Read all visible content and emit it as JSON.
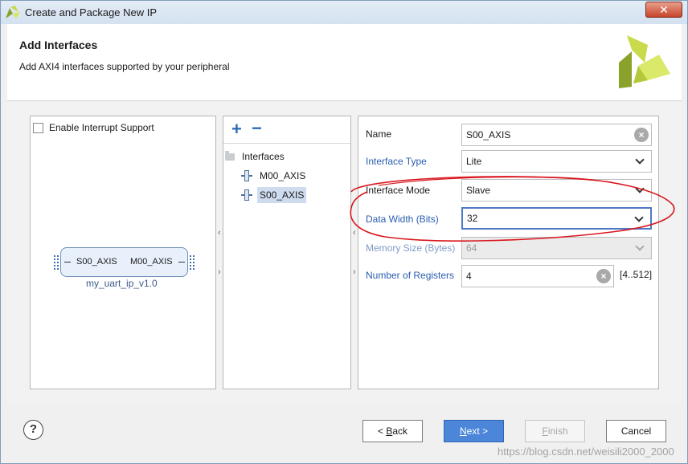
{
  "window": {
    "title": "Create and Package New IP",
    "close_label": "✕"
  },
  "header": {
    "title": "Add Interfaces",
    "subtitle": "Add AXI4 interfaces supported by your peripheral"
  },
  "left_panel": {
    "enable_interrupt_label": "Enable Interrupt Support",
    "enable_interrupt_checked": false,
    "ip_block": {
      "port_left": "S00_AXIS",
      "port_right": "M00_AXIS",
      "name": "my_uart_ip_v1.0"
    }
  },
  "middle_panel": {
    "add_label": "+",
    "remove_label": "−",
    "root_label": "Interfaces",
    "items": [
      {
        "label": "M00_AXIS",
        "selected": false
      },
      {
        "label": "S00_AXIS",
        "selected": true
      }
    ]
  },
  "right_panel": {
    "name_label": "Name",
    "name_value": "S00_AXIS",
    "interface_type_label": "Interface Type",
    "interface_type_value": "Lite",
    "interface_mode_label": "Interface Mode",
    "interface_mode_value": "Slave",
    "data_width_label": "Data Width (Bits)",
    "data_width_value": "32",
    "memory_size_label": "Memory Size (Bytes)",
    "memory_size_value": "64",
    "num_registers_label": "Number of Registers",
    "num_registers_value": "4",
    "num_registers_range": "[4..512]"
  },
  "splitters": {
    "left": "‹",
    "right": "›"
  },
  "footer": {
    "help_label": "?",
    "back_prefix": "< ",
    "back_access": "B",
    "back_rest": "ack",
    "next_access": "N",
    "next_rest": "ext >",
    "finish_access": "F",
    "finish_rest": "inish",
    "cancel_label": "Cancel"
  },
  "watermark": "https://blog.csdn.net/weisili2000_2000",
  "colors": {
    "link": "#2a5db0",
    "primary_button": "#4b86d8",
    "annotation": "#d9171f",
    "logo_dark": "#8aa12a",
    "logo_light": "#d7e85a"
  }
}
